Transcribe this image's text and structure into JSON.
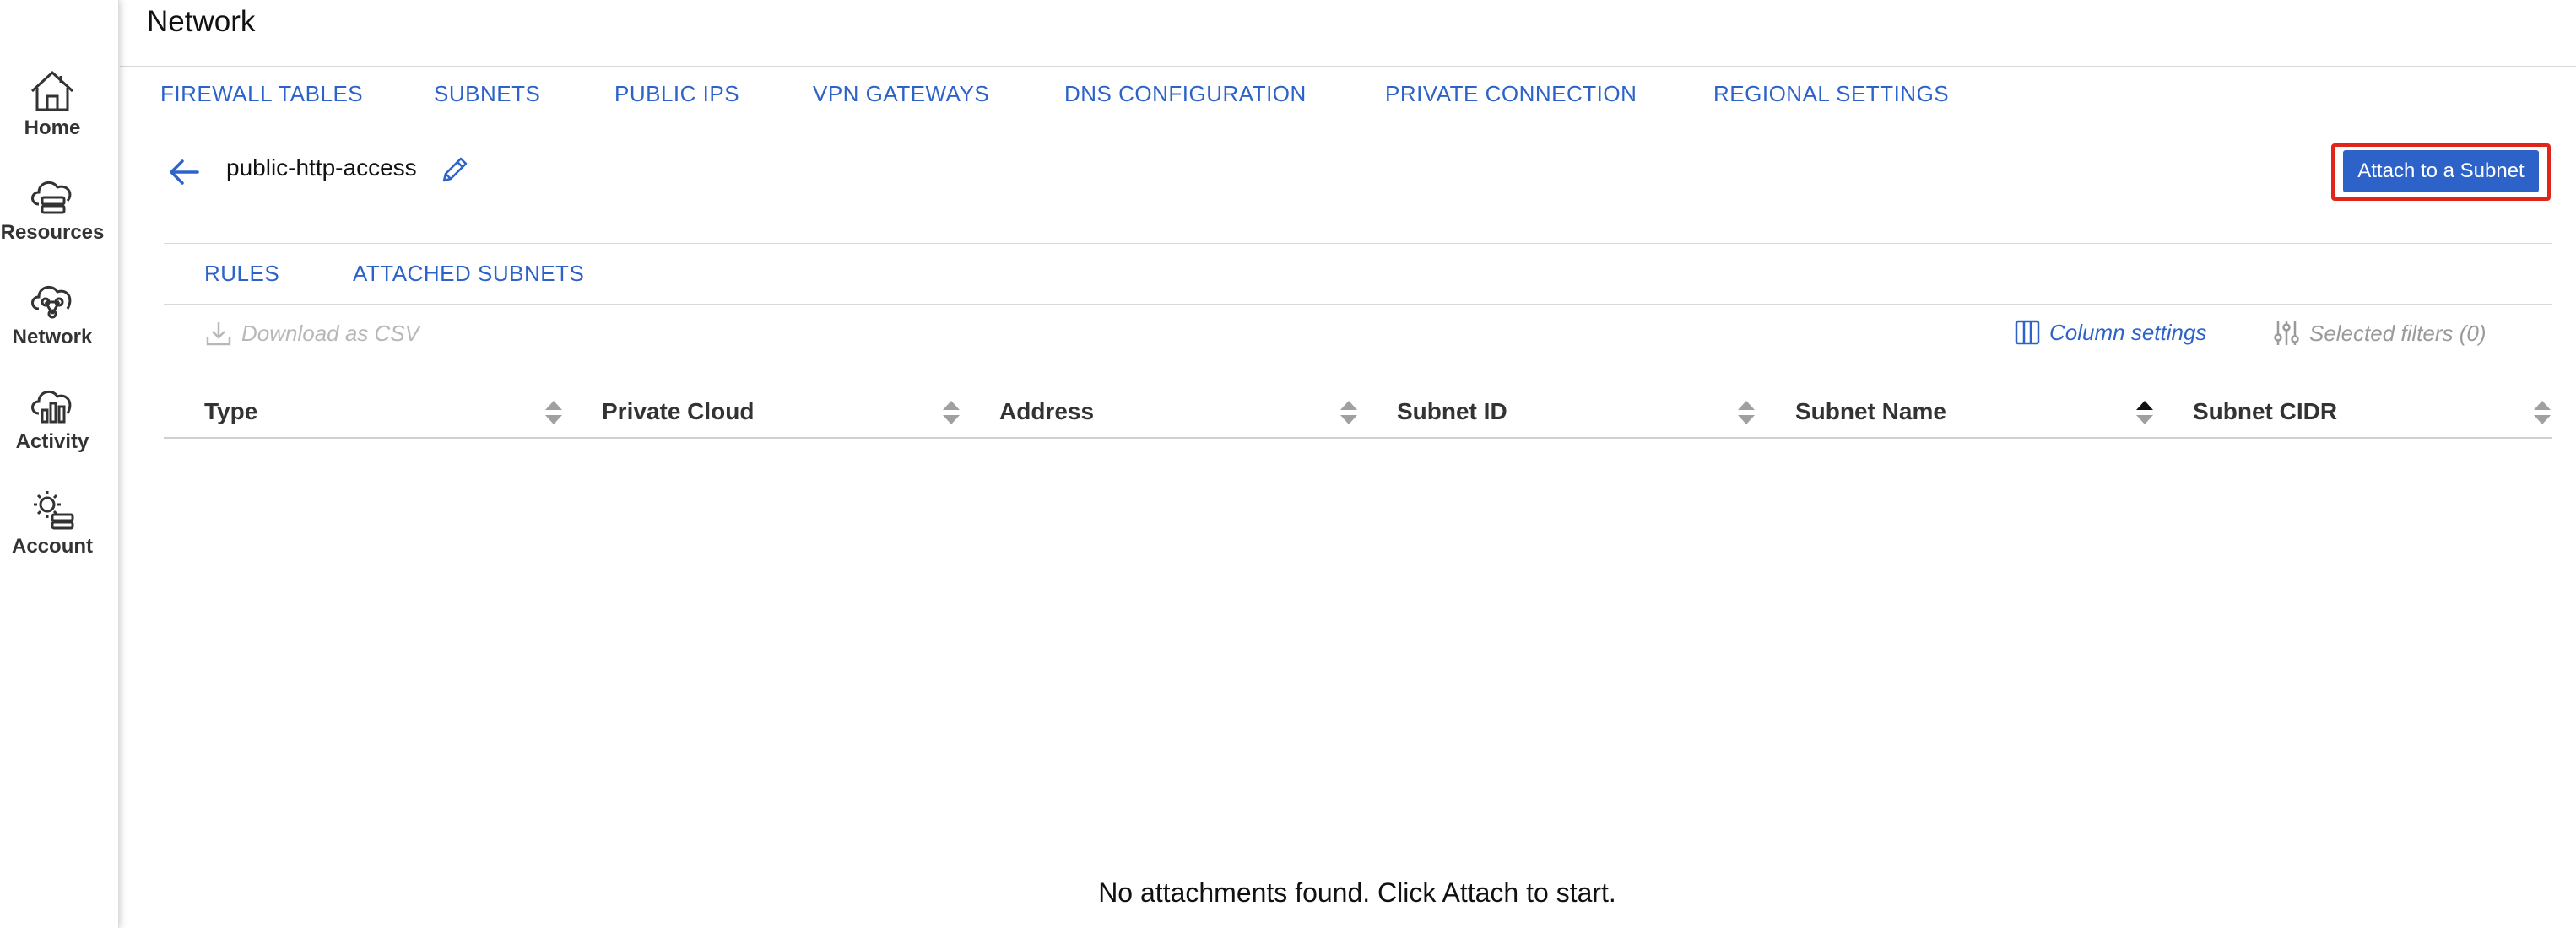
{
  "sidebar": {
    "items": [
      {
        "label": "Home",
        "icon": "home-icon"
      },
      {
        "label": "Resources",
        "icon": "cloud-server-icon"
      },
      {
        "label": "Network",
        "icon": "cloud-network-icon"
      },
      {
        "label": "Activity",
        "icon": "cloud-chart-icon"
      },
      {
        "label": "Account",
        "icon": "gear-server-icon"
      }
    ]
  },
  "header": {
    "title": "Network",
    "tabs": [
      {
        "label": "FIREWALL TABLES"
      },
      {
        "label": "SUBNETS"
      },
      {
        "label": "PUBLIC IPS"
      },
      {
        "label": "VPN GATEWAYS"
      },
      {
        "label": "DNS CONFIGURATION"
      },
      {
        "label": "PRIVATE CONNECTION"
      },
      {
        "label": "REGIONAL SETTINGS"
      }
    ]
  },
  "detail": {
    "name": "public-http-access",
    "attach_button": "Attach to a Subnet",
    "tabs": [
      {
        "label": "RULES"
      },
      {
        "label": "ATTACHED SUBNETS"
      }
    ]
  },
  "toolbar": {
    "download": "Download as CSV",
    "column_settings": "Column settings",
    "filters": "Selected filters (0)"
  },
  "table": {
    "columns": [
      {
        "label": "Type"
      },
      {
        "label": "Private Cloud"
      },
      {
        "label": "Address"
      },
      {
        "label": "Subnet ID"
      },
      {
        "label": "Subnet Name"
      },
      {
        "label": "Subnet CIDR"
      }
    ],
    "empty_message": "No attachments found. Click Attach to start."
  },
  "colors": {
    "accent": "#2d63c9",
    "highlight_outline": "#e1251b"
  }
}
